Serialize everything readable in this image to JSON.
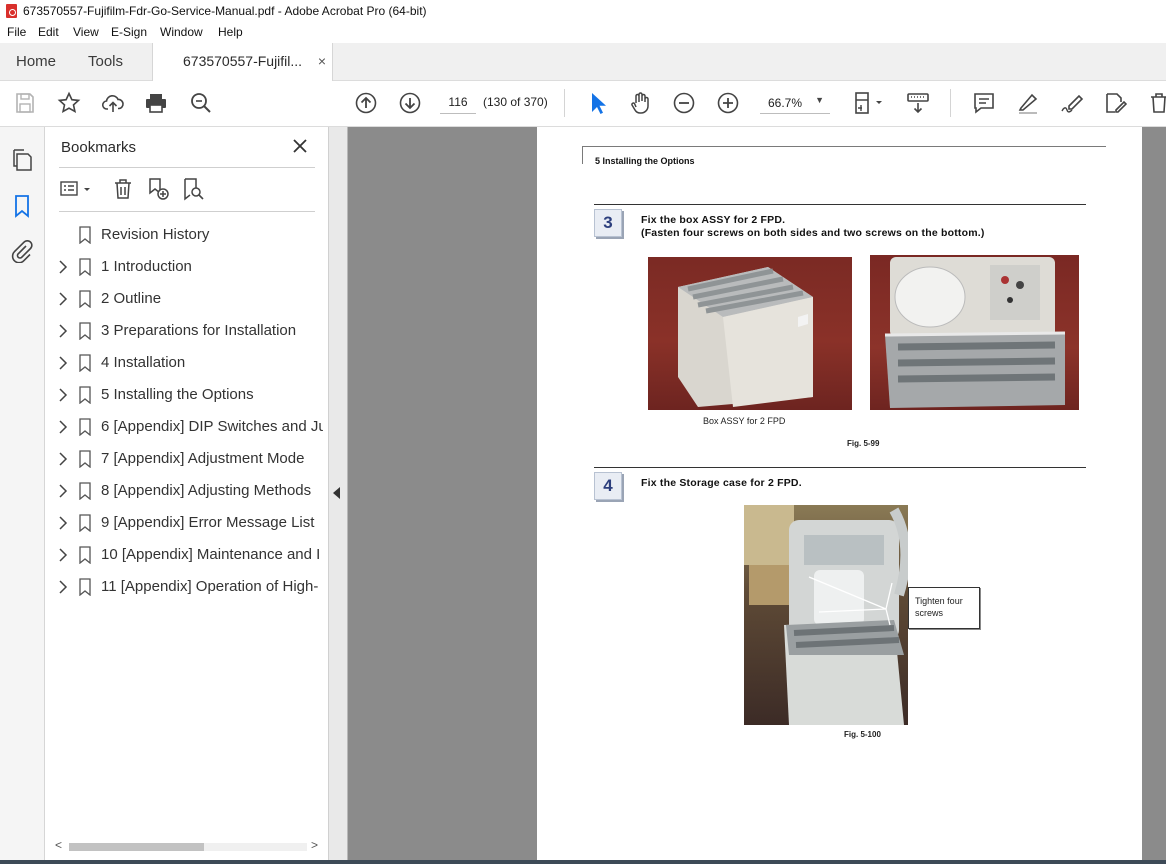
{
  "window": {
    "title": "673570557-Fujifilm-Fdr-Go-Service-Manual.pdf - Adobe Acrobat Pro (64-bit)"
  },
  "menu": [
    "File",
    "Edit",
    "View",
    "E-Sign",
    "Window",
    "Help"
  ],
  "tabs": {
    "home": "Home",
    "tools": "Tools",
    "document": "673570557-Fujifil...",
    "close": "×"
  },
  "toolbar": {
    "page_current": "116",
    "page_count": "(130 of 370)",
    "zoom": "66.7%"
  },
  "bookmarks": {
    "title": "Bookmarks",
    "items": [
      {
        "label": "Revision History",
        "expandable": false
      },
      {
        "label": "1 Introduction",
        "expandable": true
      },
      {
        "label": "2 Outline",
        "expandable": true
      },
      {
        "label": "3 Preparations for Installation",
        "expandable": true
      },
      {
        "label": "4 Installation",
        "expandable": true
      },
      {
        "label": "5 Installing the Options",
        "expandable": true
      },
      {
        "label": "6 [Appendix] DIP Switches and Ju",
        "expandable": true
      },
      {
        "label": "7 [Appendix] Adjustment Mode",
        "expandable": true
      },
      {
        "label": "8 [Appendix] Adjusting Methods",
        "expandable": true
      },
      {
        "label": "9 [Appendix] Error Message List",
        "expandable": true
      },
      {
        "label": "10 [Appendix] Maintenance and I",
        "expandable": true
      },
      {
        "label": "11 [Appendix] Operation of High-",
        "expandable": true
      }
    ]
  },
  "document": {
    "section_header": "5  Installing the Options",
    "step3": {
      "number": "3",
      "line1": "Fix  the  box  ASSY  for  2  FPD.",
      "line2": "(Fasten  four  screws  on  both  sides  and  two  screws  on  the  bottom.)",
      "caption": "Box ASSY for 2 FPD",
      "figure": "Fig.  5-99"
    },
    "step4": {
      "number": "4",
      "line1": "Fix  the  Storage  case  for  2  FPD.",
      "callout_line1": "Tighten four",
      "callout_line2": "screws",
      "figure": "Fig.  5-100"
    }
  },
  "colors": {
    "accent_blue": "#1473e6",
    "step_blue": "#2d3f7d",
    "canvas_gray": "#8b8b8b"
  }
}
